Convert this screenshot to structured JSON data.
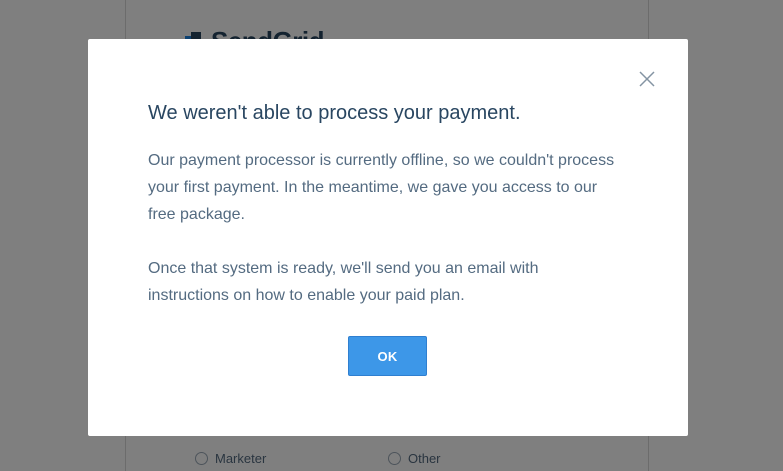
{
  "background": {
    "logo_text": "SendGrid",
    "radio_options": [
      "Marketer",
      "Other"
    ]
  },
  "modal": {
    "title": "We weren't able to process your payment.",
    "paragraphs": [
      "Our payment processor is currently offline, so we couldn't process your first payment. In the meantime, we gave you access to our free package.",
      "Once that system is ready, we'll send you an email with instructions on how to enable your paid plan."
    ],
    "ok_label": "OK",
    "close_icon": "close-icon"
  },
  "colors": {
    "primary_button": "#3d97e8",
    "title_text": "#294661",
    "body_text": "#546b81",
    "overlay": "rgba(0,0,0,0.5)"
  }
}
